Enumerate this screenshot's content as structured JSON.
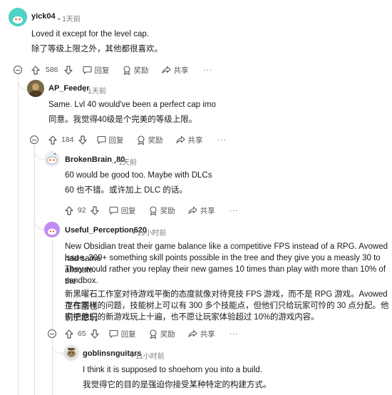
{
  "comments": [
    {
      "user": "yick04",
      "time": "1天前",
      "text_en": "Loved it except for the level cap.",
      "text_zh": "除了等级上限之外，其他都很喜欢。",
      "votes": "586"
    },
    {
      "user": "AP_Feeder",
      "time": "1天前",
      "text_en": "Same. Lvl 40 would've been a perfect cap imo",
      "text_zh": "同意。我觉得40级是个完美的等级上限。",
      "votes": "184"
    },
    {
      "user": "BrokenBrain_80",
      "time": "1天前",
      "text_en": "60 would be good too. Maybe with DLCs",
      "text_zh": "60 也不错。或许加上 DLC 的话。",
      "votes": "92"
    },
    {
      "user": "Useful_Perception620",
      "time": "19小时前",
      "text_en_lines": [
        "New Obsidian treat their game balance like a competitive FPS instead of a RPG. Avowed had same",
        "issue. 300+ something skill points possible in the tree and they give you a measly 30 to allocate.",
        "They would rather you replay their new games 10 times than play with more than 10% of the",
        "sandbox."
      ],
      "text_zh_lines": [
        "新黑曜石工作室对待游戏平衡的态度就像对待竞技 FPS 游戏，而不是 RPG 游戏。Avowed 工作室也",
        "存在同样的问题，技能树上可以有 300 多个技能点，但他们只给玩家可怜的 30 点分配。他们宁愿玩",
        "家把他们的新游戏玩上十遍，也不愿让玩家体验超过 10%的游戏内容。"
      ],
      "votes": "65"
    },
    {
      "user": "goblinsnguitars",
      "time": "11小时前",
      "text_en": "I think it is supposed to shoehorn you into a build.",
      "text_zh": "我觉得它的目的是强迫你接受某种特定的构建方式。"
    }
  ],
  "actions": {
    "reply": "回复",
    "award": "奖励",
    "share": "共享",
    "more": "···"
  },
  "dot": "•",
  "colors": {
    "avatar_teal": "#4fd1c5",
    "avatar_purple": "#c18cf0",
    "thread_line": "#dfe3e6"
  }
}
